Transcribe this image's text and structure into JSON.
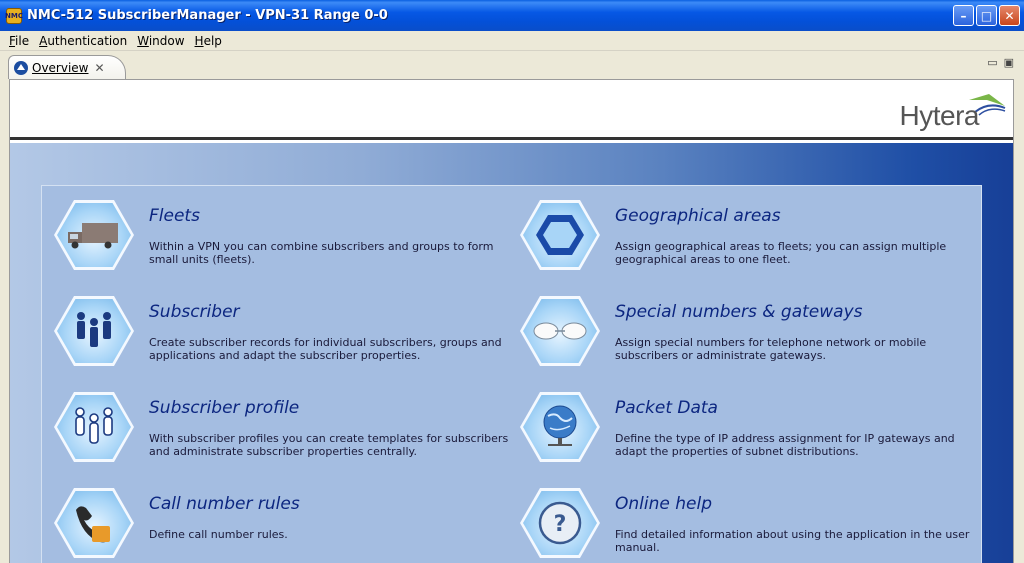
{
  "window": {
    "title": "NMC-512 SubscriberManager - VPN-31 Range 0-0",
    "app_icon_text": "NMC",
    "minimize": "–",
    "maximize": "□",
    "close": "✕"
  },
  "menu": [
    {
      "mnemonic": "F",
      "rest": "ile"
    },
    {
      "mnemonic": "A",
      "rest": "uthentication"
    },
    {
      "mnemonic": "W",
      "rest": "indow"
    },
    {
      "mnemonic": "H",
      "rest": "elp"
    }
  ],
  "tab": {
    "label": "Overview",
    "close": "✕",
    "minimize": "▭",
    "restore": "▣"
  },
  "logo": {
    "text": "Hytera"
  },
  "items": [
    {
      "title": "Fleets",
      "desc": "Within a VPN you can combine subscribers and groups to form small units (fleets).",
      "icon": "truck-icon"
    },
    {
      "title": "Geographical areas",
      "desc": "Assign geographical areas to fleets; you can assign multiple geographical areas to one fleet.",
      "icon": "hexagon-area-icon"
    },
    {
      "title": "Subscriber",
      "desc": "Create subscriber records for individual subscribers, groups and applications and adapt the subscriber properties.",
      "icon": "people-icon"
    },
    {
      "title": "Special numbers & gateways",
      "desc": "Assign special numbers for telephone network or mobile subscribers or administrate gateways.",
      "icon": "cloud-gateway-icon"
    },
    {
      "title": "Subscriber profile",
      "desc": "With subscriber profiles you can create templates for subscribers and administrate subscriber properties centrally.",
      "icon": "profile-outline-icon"
    },
    {
      "title": "Packet Data",
      "desc": "Define the type of IP address assignment for IP gateways and adapt the properties of subnet distributions.",
      "icon": "globe-network-icon"
    },
    {
      "title": "Call number rules",
      "desc": "Define call number rules.",
      "icon": "phone-icon"
    },
    {
      "title": "Online help",
      "desc": "Find detailed information about using the application in the user manual.",
      "icon": "help-icon"
    }
  ]
}
